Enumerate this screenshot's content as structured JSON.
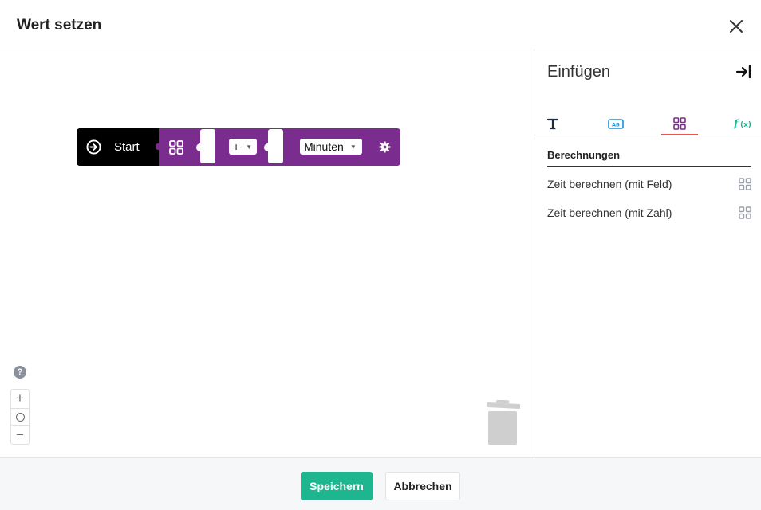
{
  "dialog": {
    "title": "Wert setzen"
  },
  "workspace": {
    "start_block": {
      "label": "Start"
    },
    "calc_block": {
      "operator": "+",
      "unit": "Minuten"
    },
    "help_label": "?"
  },
  "panel": {
    "title": "Einfügen",
    "tabs": [
      {
        "icon": "text-type-icon",
        "color": "#1f2a44"
      },
      {
        "icon": "ab-field-icon",
        "color": "#1b8fd6"
      },
      {
        "icon": "calculation-grid-icon",
        "color": "#7b2d8f",
        "active": true
      },
      {
        "icon": "function-icon",
        "color": "#1db68e"
      }
    ],
    "section_title": "Berechnungen",
    "items": [
      {
        "label": "Zeit berechnen (mit Feld)"
      },
      {
        "label": "Zeit berechnen (mit Zahl)"
      }
    ]
  },
  "footer": {
    "save_label": "Speichern",
    "cancel_label": "Abbrechen"
  },
  "colors": {
    "accent_green": "#1db68e",
    "block_purple": "#7b2d8f",
    "active_tab_underline": "#e8554e"
  }
}
